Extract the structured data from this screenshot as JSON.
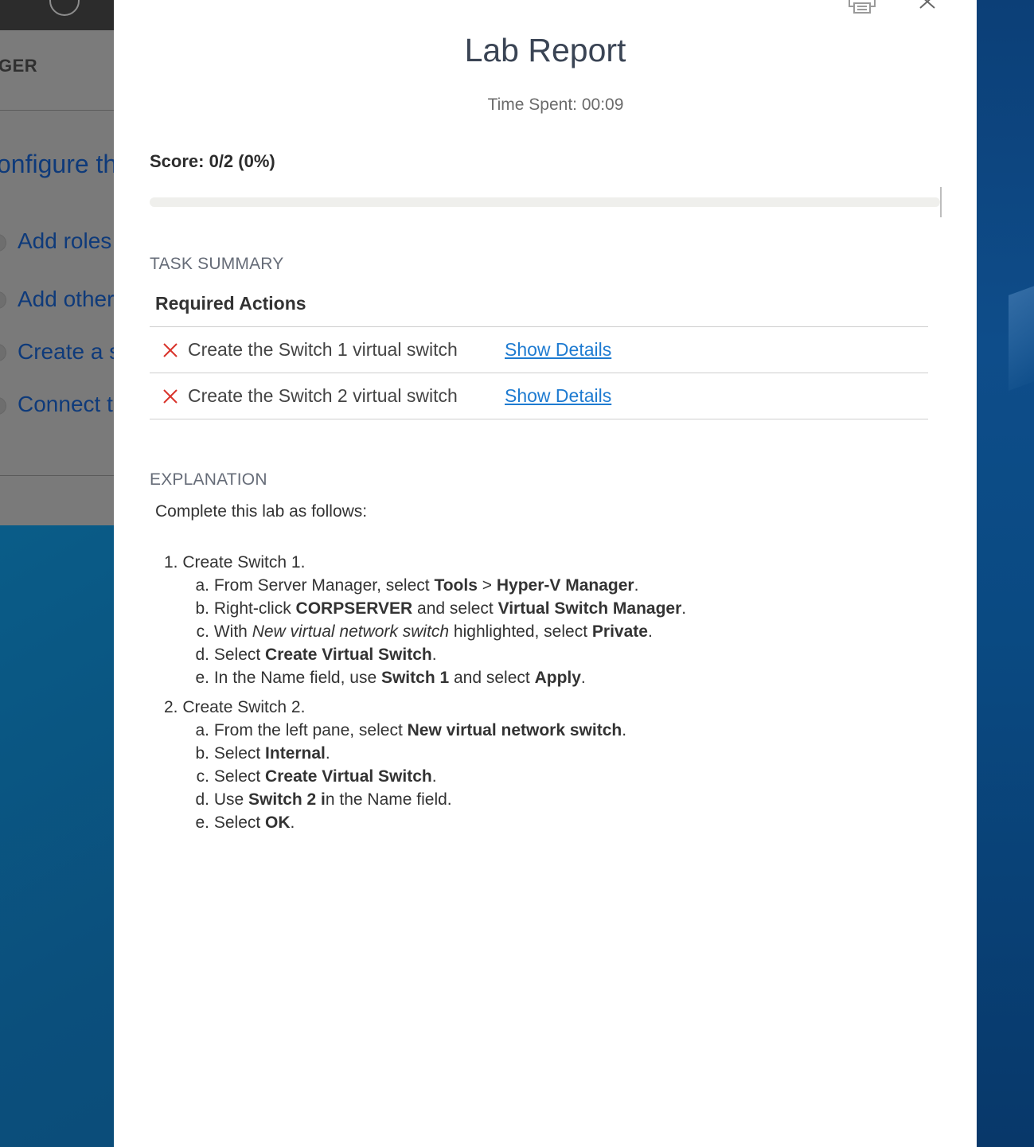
{
  "background": {
    "header_text": "GER",
    "title_text": "onfigure th",
    "items": [
      "Add roles a",
      "Add other",
      "Create a se",
      "Connect th"
    ]
  },
  "modal": {
    "title": "Lab Report",
    "time_spent": "Time Spent: 00:09",
    "score": "Score: 0/2 (0%)",
    "progress_fraction": 0,
    "task_summary_label": "TASK SUMMARY",
    "required_actions_label": "Required Actions",
    "tasks": [
      {
        "name": "Create the Switch 1 virtual switch",
        "status": "failed",
        "link": "Show Details"
      },
      {
        "name": "Create the Switch 2 virtual switch",
        "status": "failed",
        "link": "Show Details"
      }
    ],
    "explanation_label": "EXPLANATION",
    "explanation_intro": "Complete this lab as follows:",
    "steps": [
      {
        "text": "1. Create Switch 1.",
        "subs": [
          {
            "letter": "a.",
            "parts": [
              [
                "From Server Manager, select ",
                0
              ],
              [
                "Tools",
                1
              ],
              [
                " > ",
                0
              ],
              [
                "Hyper-V Manager",
                1
              ],
              [
                ".",
                0
              ]
            ]
          },
          {
            "letter": "b.",
            "parts": [
              [
                "Right-click ",
                0
              ],
              [
                "CORPSERVER",
                1
              ],
              [
                " and select ",
                0
              ],
              [
                "Virtual Switch Manager",
                1
              ],
              [
                ".",
                0
              ]
            ]
          },
          {
            "letter": "c.",
            "parts": [
              [
                "With ",
                0
              ],
              [
                "New virtual network switch",
                2
              ],
              [
                " highlighted, select ",
                0
              ],
              [
                "Private",
                1
              ],
              [
                ".",
                0
              ]
            ]
          },
          {
            "letter": "d.",
            "parts": [
              [
                "Select ",
                0
              ],
              [
                "Create Virtual Switch",
                1
              ],
              [
                ".",
                0
              ]
            ]
          },
          {
            "letter": "e.",
            "parts": [
              [
                "In the Name field, use ",
                0
              ],
              [
                "Switch 1",
                1
              ],
              [
                " and select ",
                0
              ],
              [
                "Apply",
                1
              ],
              [
                ".",
                0
              ]
            ]
          }
        ]
      },
      {
        "text": "2. Create Switch 2.",
        "subs": [
          {
            "letter": "a.",
            "parts": [
              [
                "From the left pane, select ",
                0
              ],
              [
                "New virtual network switch",
                1
              ],
              [
                ".",
                0
              ]
            ]
          },
          {
            "letter": "b.",
            "parts": [
              [
                "Select ",
                0
              ],
              [
                "Internal",
                1
              ],
              [
                ".",
                0
              ]
            ]
          },
          {
            "letter": "c.",
            "parts": [
              [
                "Select ",
                0
              ],
              [
                "Create Virtual Switch",
                1
              ],
              [
                ".",
                0
              ]
            ]
          },
          {
            "letter": "d.",
            "parts": [
              [
                "Use ",
                0
              ],
              [
                "Switch 2 i",
                1
              ],
              [
                "n the Name field.",
                0
              ]
            ]
          },
          {
            "letter": "e.",
            "parts": [
              [
                "Select ",
                0
              ],
              [
                "OK",
                1
              ],
              [
                ".",
                0
              ]
            ]
          }
        ]
      }
    ]
  },
  "colors": {
    "fail_x": "#d9342b",
    "link": "#1e7bd1",
    "title": "#3a4454"
  },
  "icons": {
    "print": "printer-icon",
    "close": "close-icon",
    "fail": "x-mark-icon"
  }
}
